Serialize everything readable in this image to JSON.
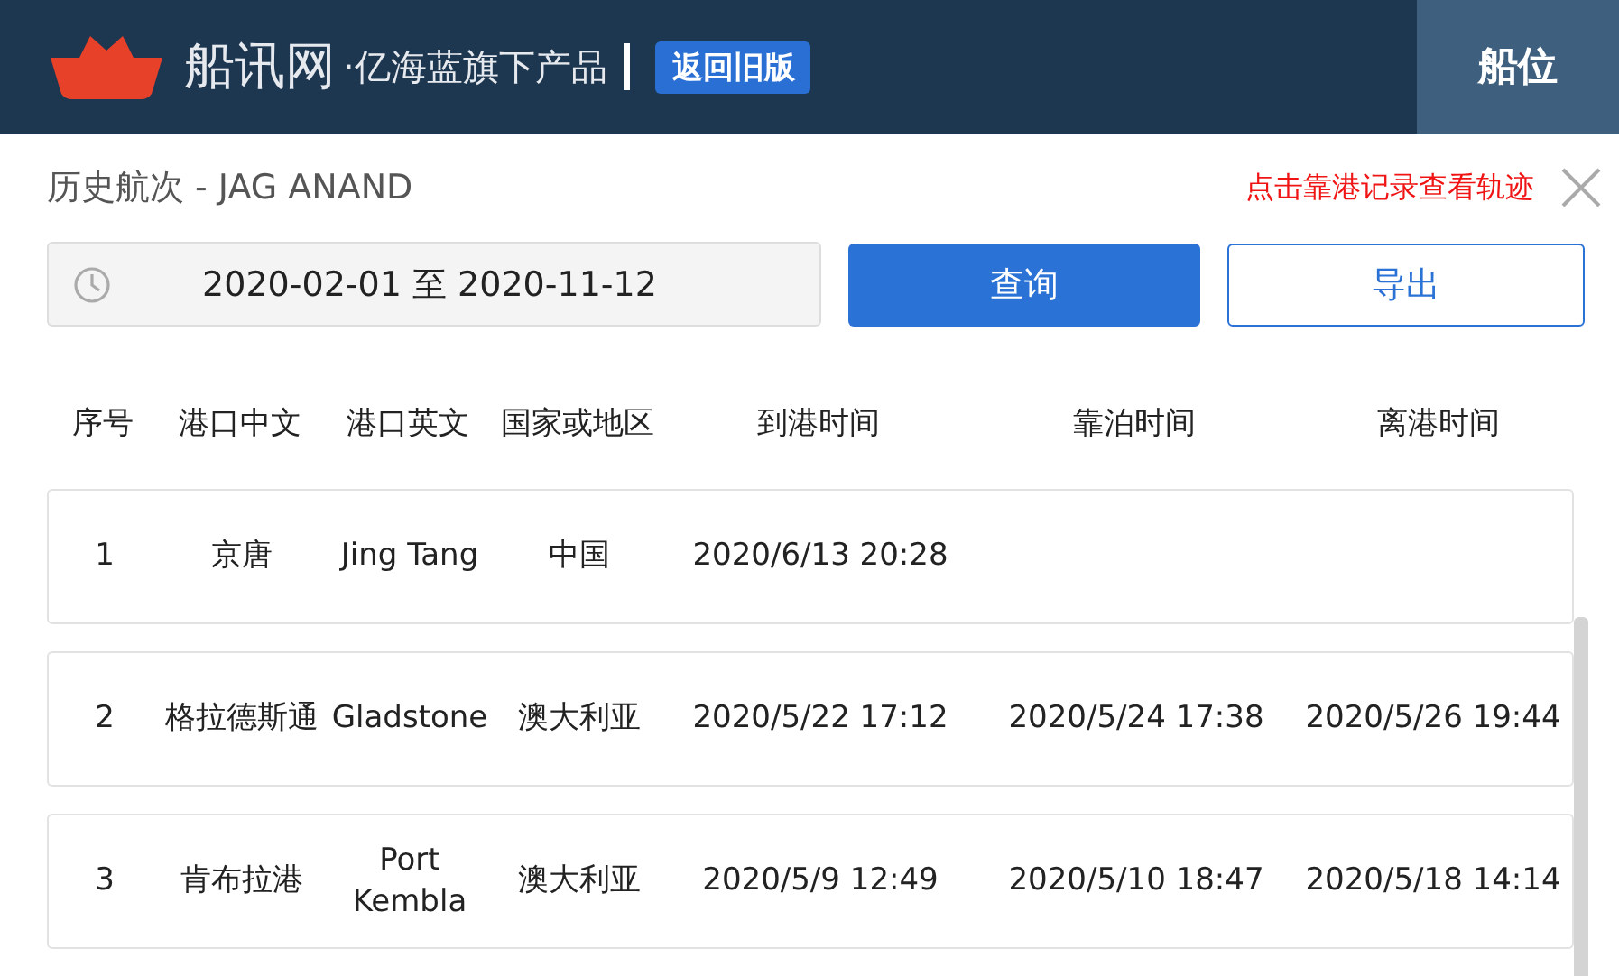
{
  "header": {
    "brand": "船讯网",
    "tagline": "·亿海蓝旗下产品",
    "old_version_button": "返回旧版",
    "tabs": [
      {
        "label": "船位",
        "selected": true
      }
    ]
  },
  "panel": {
    "title": "历史航次 - JAG ANAND",
    "hint": "点击靠港记录查看轨迹",
    "date_range": "2020-02-01 至 2020-11-12",
    "query_button": "查询",
    "export_button": "导出"
  },
  "table": {
    "columns": [
      "序号",
      "港口中文",
      "港口英文",
      "国家或地区",
      "到港时间",
      "靠泊时间",
      "离港时间"
    ],
    "rows": [
      {
        "cells": [
          "1",
          "京唐",
          "Jing Tang",
          "中国",
          "2020/6/13 20:28",
          "",
          ""
        ]
      },
      {
        "cells": [
          "2",
          "格拉德斯通",
          "Gladstone",
          "澳大利亚",
          "2020/5/22 17:12",
          "2020/5/24 17:38",
          "2020/5/26 19:44"
        ]
      },
      {
        "cells": [
          "3",
          "肯布拉港",
          "Port Kembla",
          "澳大利亚",
          "2020/5/9 12:49",
          "2020/5/10 18:47",
          "2020/5/18 14:14"
        ]
      }
    ]
  }
}
